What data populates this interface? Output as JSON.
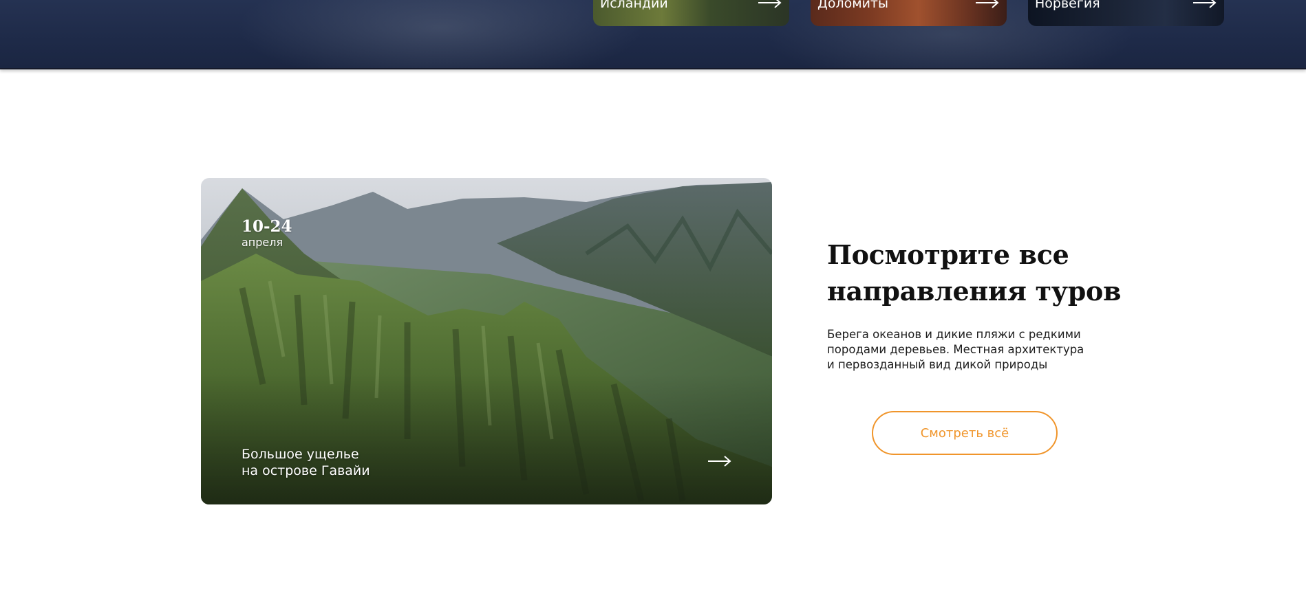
{
  "top_strip": {
    "destinations": [
      {
        "label": "Исландии"
      },
      {
        "label": "Доломиты"
      },
      {
        "label": "Норвегия"
      }
    ]
  },
  "tour_card": {
    "date_range": "10-24",
    "date_month": "апреля",
    "title_line1": "Большое ущелье",
    "title_line2": "на острове Гавайи"
  },
  "promo": {
    "heading_line1": "Посмотрите все",
    "heading_line2": "направления туров",
    "description_line1": "Берега океанов и дикие пляжи с редкими",
    "description_line2": "породами деревьев. Местная архитектура",
    "description_line3": "и первозданный вид дикой природы",
    "cta_label": "Смотреть всё"
  },
  "colors": {
    "accent": "#f0952b",
    "hero_bg": "#1e2a48",
    "heading_text": "#111111"
  },
  "icons": [
    "arrow-right-icon"
  ]
}
